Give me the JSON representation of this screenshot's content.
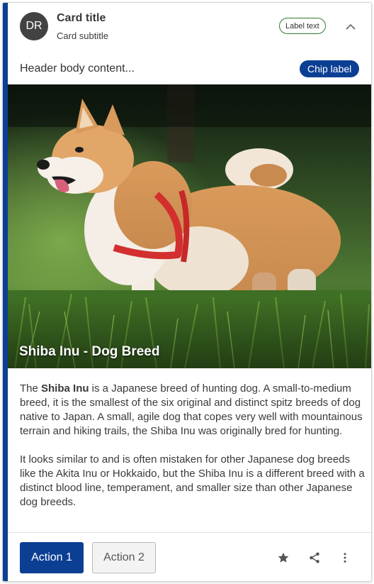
{
  "header": {
    "avatar_initials": "DR",
    "title": "Card title",
    "subtitle": "Card subtitle",
    "label_badge": "Label text",
    "body": "Header body content...",
    "chip": "Chip label"
  },
  "media": {
    "title": "Shiba Inu - Dog Breed",
    "image_subject": "Shiba Inu dog standing in grass"
  },
  "content": {
    "p1_prefix": "The ",
    "p1_bold": "Shiba Inu",
    "p1_rest": " is a Japanese breed of hunting dog. A small-to-medium breed, it is the smallest of the six original and distinct spitz breeds of dog native to Japan. A small, agile dog that copes very well with mountainous terrain and hiking trails, the Shiba Inu was originally bred for hunting.",
    "p2": "It looks similar to and is often mistaken for other Japanese dog breeds like the Akita Inu or Hokkaido, but the Shiba Inu is a different breed with a distinct blood line, temperament, and smaller size than other Japanese dog breeds."
  },
  "actions": {
    "primary_label": "Action 1",
    "secondary_label": "Action 2",
    "icons": [
      "star-icon",
      "share-icon",
      "more-vertical-icon"
    ]
  },
  "colors": {
    "accent": "#0b3f94",
    "label_border": "#2e7d32"
  }
}
